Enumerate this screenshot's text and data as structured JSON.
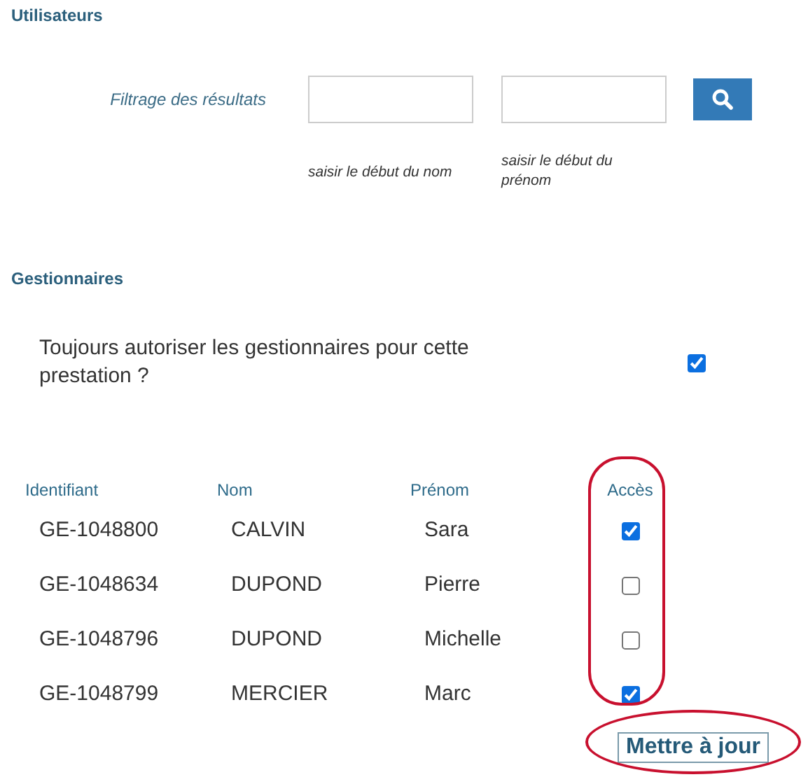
{
  "users_section": {
    "title": "Utilisateurs",
    "filter_label": "Filtrage des résultats",
    "fields": [
      {
        "hint": "saisir le début du nom"
      },
      {
        "hint": "saisir le début du prénom"
      }
    ]
  },
  "managers_section": {
    "title": "Gestionnaires",
    "always_allow": {
      "label": "Toujours autoriser les gestionnaires pour cette prestation ?",
      "checked": true
    }
  },
  "table": {
    "columns": [
      "Identifiant",
      "Nom",
      "Prénom",
      "Accès"
    ],
    "rows": [
      {
        "id": "GE-1048800",
        "nom": "CALVIN",
        "prenom": "Sara",
        "access": true
      },
      {
        "id": "GE-1048634",
        "nom": "DUPOND",
        "prenom": "Pierre",
        "access": false
      },
      {
        "id": "GE-1048796",
        "nom": "DUPOND",
        "prenom": "Michelle",
        "access": false
      },
      {
        "id": "GE-1048799",
        "nom": "MERCIER",
        "prenom": "Marc",
        "access": true
      }
    ]
  },
  "update_button": "Mettre à jour"
}
